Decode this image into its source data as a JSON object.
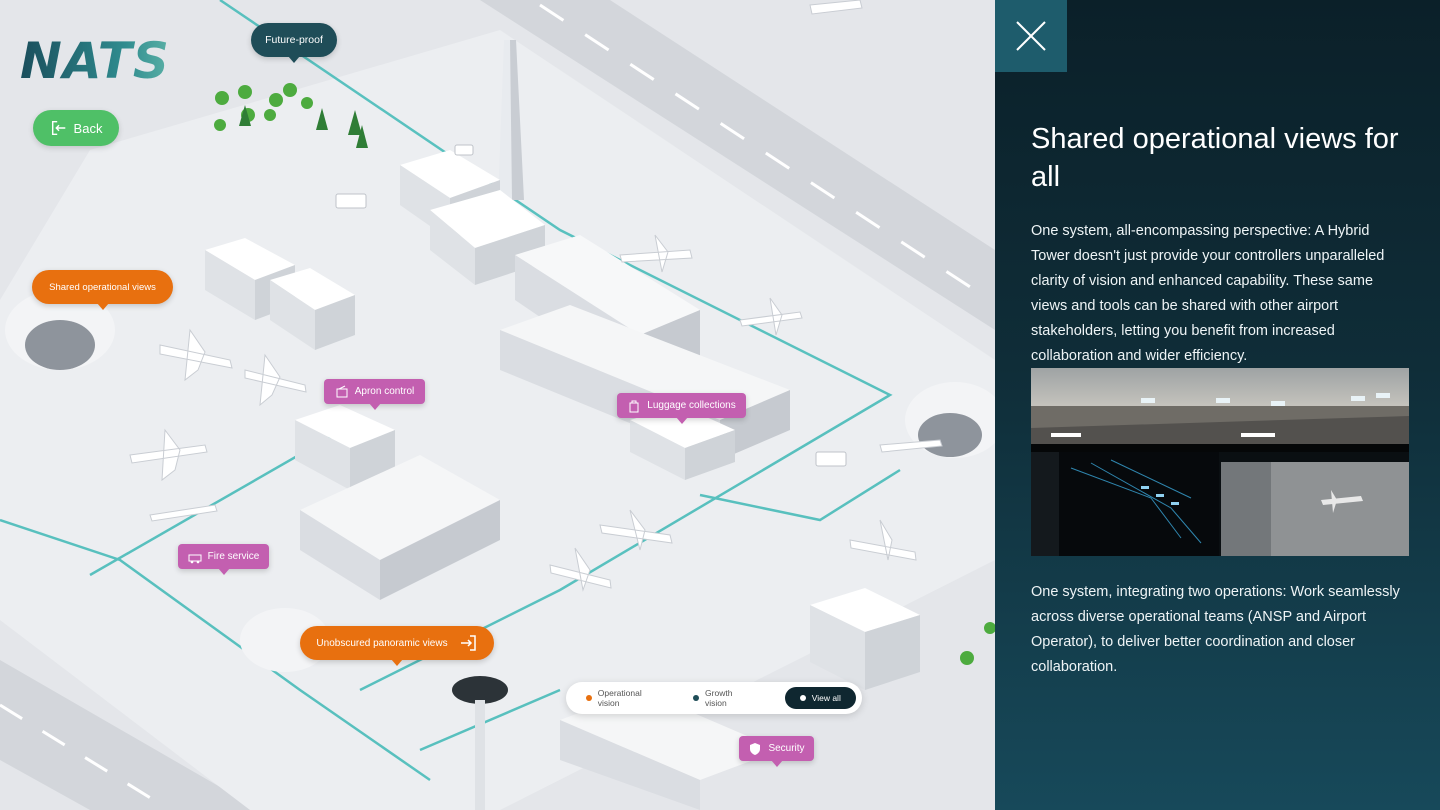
{
  "brand": {
    "logo_text": "NATS"
  },
  "nav": {
    "back_label": "Back"
  },
  "map": {
    "markers": {
      "future_proof": "Future-proof",
      "shared_views": "Shared operational views",
      "apron_control": "Apron control",
      "luggage": "Luggage collections",
      "fire_service": "Fire service",
      "panoramic": "Unobscured panoramic views",
      "security": "Security"
    },
    "legend": {
      "operational": "Operational vision",
      "growth": "Growth vision",
      "view_all": "View all"
    }
  },
  "panel": {
    "title": "Shared operational views for all",
    "paragraph_1": "One system, all-encompassing perspective: A Hybrid Tower doesn't just provide your controllers unparalleled clarity of vision and enhanced capability. These same views and tools can be shared with other airport stakeholders, letting you benefit from increased collaboration and wider efficiency.",
    "paragraph_2": "One system, integrating two operations: Work seamlessly across diverse operational teams (ANSP and Airport Operator), to deliver better coordination and closer collaboration."
  },
  "colors": {
    "orange": "#e8700f",
    "teal": "#1f4d58",
    "pink": "#c35fb0",
    "green": "#4fc067",
    "panel_bg": "#0f2d38"
  }
}
